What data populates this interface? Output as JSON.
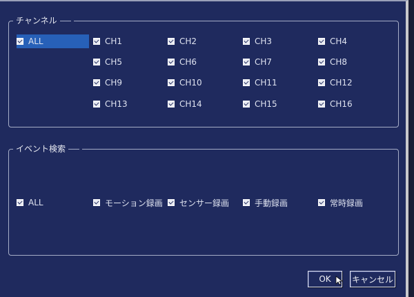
{
  "channel_group": {
    "title": "チャンネル",
    "all_label": "ALL",
    "channels": [
      "CH1",
      "CH2",
      "CH3",
      "CH4",
      "CH5",
      "CH6",
      "CH7",
      "CH8",
      "CH9",
      "CH10",
      "CH11",
      "CH12",
      "CH13",
      "CH14",
      "CH15",
      "CH16"
    ]
  },
  "event_group": {
    "title": "イベント検索",
    "all_label": "ALL",
    "events": [
      "モーション録画",
      "センサー録画",
      "手動録画",
      "常時録画"
    ]
  },
  "buttons": {
    "ok": "OK",
    "cancel": "キャンセル"
  },
  "colors": {
    "background": "#1f2a5e",
    "selected": "#2760b8",
    "border": "#a7aec7"
  }
}
